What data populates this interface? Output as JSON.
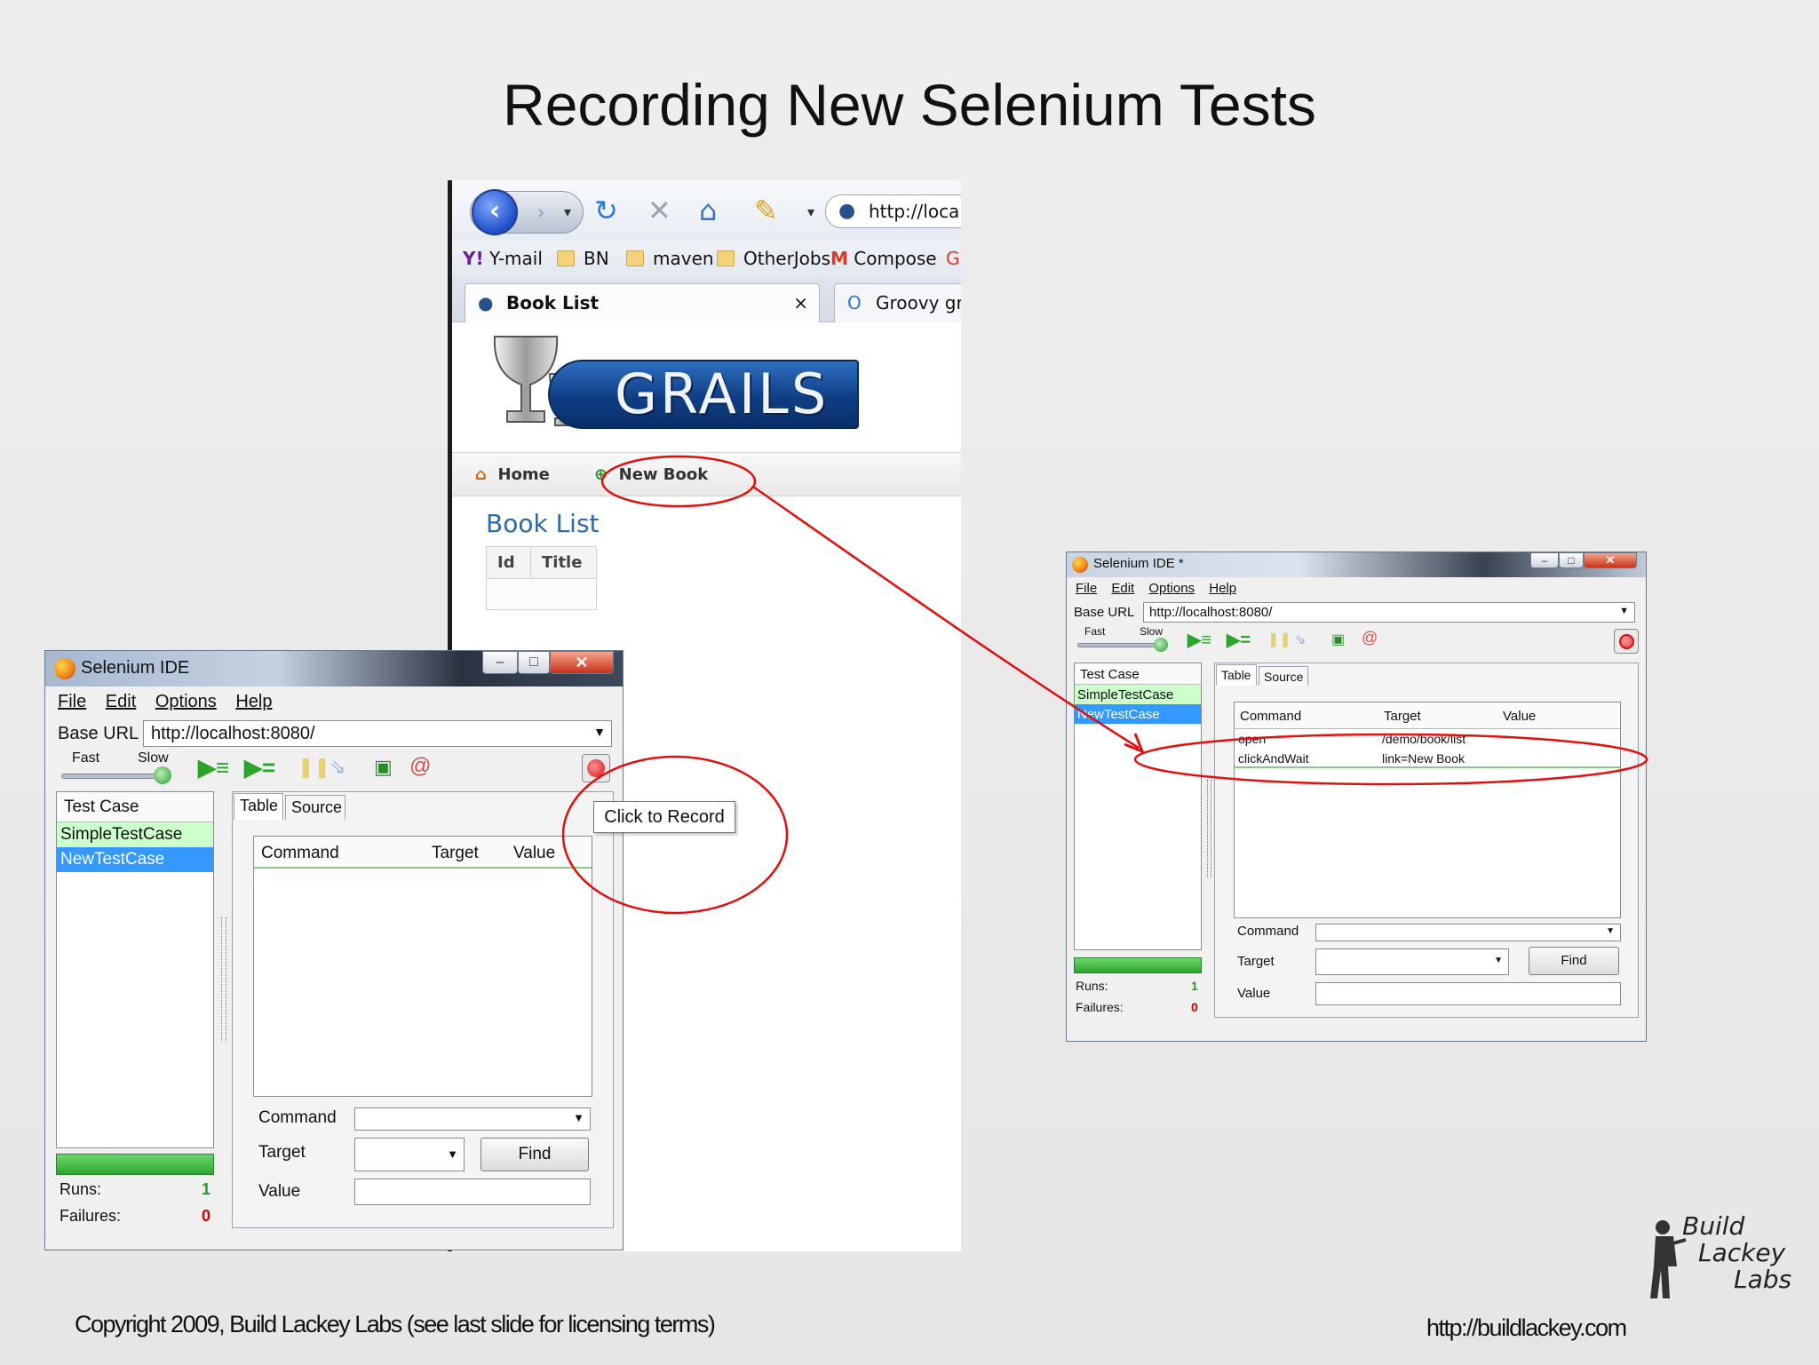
{
  "slide": {
    "title": "Recording New Selenium Tests",
    "copyright": "Copyright 2009, Build Lackey Labs  (see last slide for licensing terms)",
    "url": "http://buildlackey.com",
    "logo": {
      "line1": "Build",
      "line2": "Lackey",
      "line3": "Labs"
    }
  },
  "browser": {
    "url_partial": "http://localh",
    "bookmarks": [
      "Y-mail",
      "BN",
      "maven",
      "OtherJobs",
      "Compose"
    ],
    "tabs": [
      {
        "label": "Book List",
        "close": "×"
      },
      {
        "label": "Groovy gra"
      }
    ],
    "logo_text": "GRAILS",
    "nav": {
      "home": "Home",
      "new_book": "New Book"
    },
    "page_heading": "Book List",
    "table_headers": [
      "Id",
      "Title"
    ],
    "icons": [
      "back-icon",
      "forward-icon",
      "reload-icon",
      "stop-icon",
      "home-icon",
      "pencil-icon"
    ]
  },
  "ide_large": {
    "title": "Selenium IDE",
    "menu": [
      "File",
      "Edit",
      "Options",
      "Help"
    ],
    "base_url_label": "Base URL",
    "base_url_value": "http://localhost:8080/",
    "speed": {
      "fast": "Fast",
      "slow": "Slow"
    },
    "test_case_header": "Test Case",
    "test_cases": [
      "SimpleTestCase",
      "NewTestCase"
    ],
    "subtabs": [
      "Table",
      "Source"
    ],
    "columns": [
      "Command",
      "Target",
      "Value"
    ],
    "rows": [],
    "fields": {
      "command": "Command",
      "target": "Target",
      "value": "Value",
      "find": "Find"
    },
    "runs_label": "Runs:",
    "runs": "1",
    "failures_label": "Failures:",
    "failures": "0",
    "tooltip": "Click to Record",
    "win_buttons": [
      "–",
      "□",
      "✕"
    ]
  },
  "ide_small": {
    "title": "Selenium IDE *",
    "menu": [
      "File",
      "Edit",
      "Options",
      "Help"
    ],
    "base_url_label": "Base URL",
    "base_url_value": "http://localhost:8080/",
    "speed": {
      "fast": "Fast",
      "slow": "Slow"
    },
    "test_case_header": "Test Case",
    "test_cases": [
      "SimpleTestCase",
      "NewTestCase"
    ],
    "subtabs": [
      "Table",
      "Source"
    ],
    "columns": [
      "Command",
      "Target",
      "Value"
    ],
    "rows": [
      {
        "command": "open",
        "target": "/demo/book/list",
        "value": ""
      },
      {
        "command": "clickAndWait",
        "target": "link=New Book",
        "value": ""
      }
    ],
    "fields": {
      "command": "Command",
      "target": "Target",
      "value": "Value",
      "find": "Find"
    },
    "runs_label": "Runs:",
    "runs": "1",
    "failures_label": "Failures:",
    "failures": "0",
    "win_buttons": [
      "–",
      "□",
      "✕"
    ]
  },
  "colors": {
    "annotation": "#e01010",
    "selected_row": "#3399ff",
    "passed_row": "#ccffcc",
    "progress_green": "#3fbf3f",
    "runs_green": "#2a9a2a",
    "failures_red": "#d00000"
  }
}
